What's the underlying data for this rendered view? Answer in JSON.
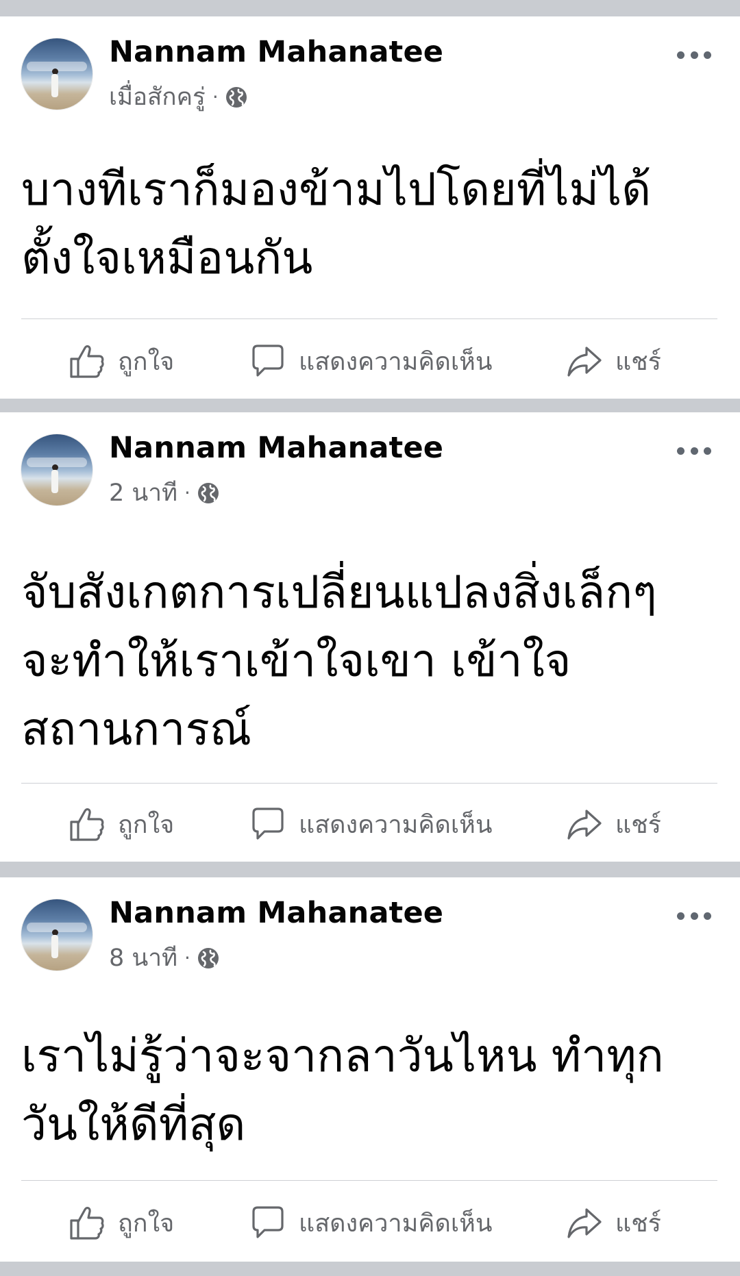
{
  "posts": [
    {
      "author": "Nannam Mahanatee",
      "time": "เมื่อสักครู่",
      "separator": "·",
      "privacy_icon": "globe-icon",
      "text": "บางทีเราก็มองข้ามไปโดยที่ไม่ได้ตั้งใจเหมือนกัน",
      "actions": {
        "like": "ถูกใจ",
        "comment": "แสดงความคิดเห็น",
        "share": "แชร์"
      }
    },
    {
      "author": "Nannam Mahanatee",
      "time": "2 นาที",
      "separator": "·",
      "privacy_icon": "globe-icon",
      "text": "จับสังเกตการเปลี่ยนแปลงสิ่งเล็กๆ จะทำให้เราเข้าใจเขา เข้าใจสถานการณ์",
      "actions": {
        "like": "ถูกใจ",
        "comment": "แสดงความคิดเห็น",
        "share": "แชร์"
      }
    },
    {
      "author": "Nannam Mahanatee",
      "time": "8 นาที",
      "separator": "·",
      "privacy_icon": "globe-icon",
      "text": "เราไม่รู้ว่าจะจากลาวันไหน ทำทุกวันให้ดีที่สุด",
      "actions": {
        "like": "ถูกใจ",
        "comment": "แสดงความคิดเห็น",
        "share": "แชร์"
      }
    }
  ],
  "icons": {
    "more": "more-options-icon",
    "like": "thumbs-up-icon",
    "comment": "comment-bubble-icon",
    "share": "share-arrow-icon"
  },
  "colors": {
    "feed_background": "#c9ccd1",
    "card_background": "#ffffff",
    "secondary_text": "#65676b",
    "primary_text": "#050505"
  }
}
